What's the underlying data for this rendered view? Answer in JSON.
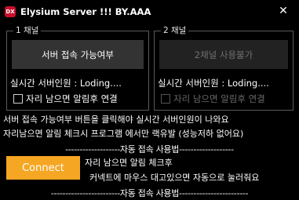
{
  "window": {
    "icon_text": "DX",
    "title": "Elysium Server !!! BY.AAA",
    "close_glyph": "✕"
  },
  "server1": {
    "group_label": "1 채널",
    "button_label": "서버 접속 가능여부",
    "users_text": "실시간 서버인원 : Loding....",
    "checkbox_label": "자리 남으면 알림후 연결"
  },
  "server2": {
    "group_label": "2 채널",
    "button_label": "2채널 사용불가",
    "users_text": "실시간 서버인원 : Loding....",
    "checkbox_label": "자리 남으면 알림후 연결"
  },
  "info": {
    "line1": "서버 접속 가능여부 버튼을 클릭해야 실시간 서버인원이 나와요",
    "line2": "자리남으면 알림 체크시 프로그램 에서만 랙유발 (성능저하 없어요)"
  },
  "auto_connect": {
    "separator_top": "-------------------자동 접속 사용법-------------------",
    "button_label": "Connect",
    "desc_line1": "자리 남으면 알림 체크후",
    "desc_line2": "커넥트에 마우스 대고있으면 자동으로 눌러줘요",
    "separator_bottom": "------------------------자동 접속 사용법------------------------"
  },
  "colors": {
    "connect_button": "#f5a623",
    "app_icon": "#c8102e"
  }
}
